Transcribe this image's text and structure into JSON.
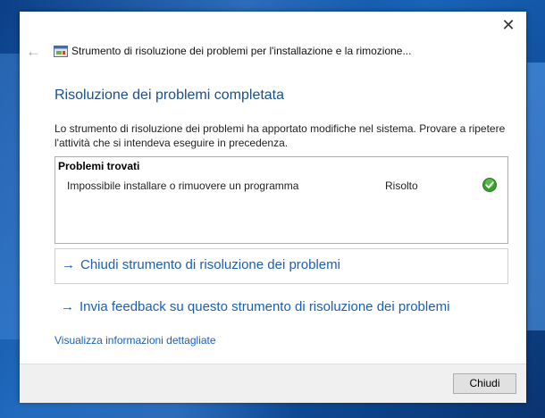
{
  "window": {
    "title": "Strumento di risoluzione dei problemi per l'installazione e la rimozione...",
    "close_symbol": "✕",
    "back_symbol": "←"
  },
  "content": {
    "heading": "Risoluzione dei problemi completata",
    "description": "Lo strumento di risoluzione dei problemi ha apportato modifiche nel sistema. Provare a ripetere l'attività che si intendeva eseguire in precedenza.",
    "problems": {
      "header": "Problemi trovati",
      "items": [
        {
          "name": "Impossibile installare o rimuovere un programma",
          "status": "Risolto",
          "status_icon": "check-icon"
        }
      ]
    },
    "links": {
      "close_tool": "Chiudi strumento di risoluzione dei problemi",
      "send_feedback": "Invia feedback su questo strumento di risoluzione dei problemi",
      "details": "Visualizza informazioni dettagliate",
      "arrow": "→"
    }
  },
  "footer": {
    "close_label": "Chiudi"
  },
  "colors": {
    "link": "#1a5fb4",
    "heading": "#1a4f8b",
    "check": "#3a9d2e",
    "desktop": "#1863b8"
  }
}
